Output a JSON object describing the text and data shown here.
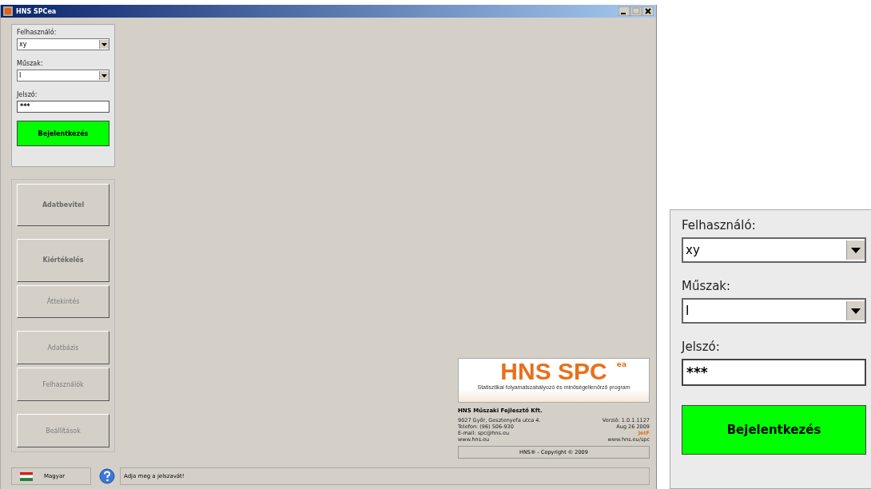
{
  "window": {
    "title": "HNS SPCea"
  },
  "login": {
    "user_label": "Felhasználó:",
    "user_value": "xy",
    "shift_label": "Műszak:",
    "shift_value": "I",
    "password_label": "Jelszó:",
    "password_value": "***",
    "login_button": "Bejelentkezés"
  },
  "nav_buttons": [
    {
      "label": "Adatbevitel",
      "disabled": false,
      "gap_before": false
    },
    {
      "label": "Kiértékelés",
      "disabled": false,
      "gap_before": true
    },
    {
      "label": "Áttekintés",
      "disabled": true,
      "gap_before": false
    },
    {
      "label": "Adatbázis",
      "disabled": true,
      "gap_before": true
    },
    {
      "label": "Felhasználók",
      "disabled": true,
      "gap_before": false
    },
    {
      "label": "Beállítások",
      "disabled": true,
      "gap_before": true
    }
  ],
  "about": {
    "logo_text": "HNS SPC",
    "logo_sup": "ea",
    "logo_subtitle": "Statisztikai folyamatszabályozó és minőségellenőrző program",
    "company": "HNS Műszaki Fejlesztő Kft.",
    "left_lines": [
      "9027 Győr, Gesztenyefa utca 4.",
      "Telefon: (96) 506-930",
      "E-mail: spc@hns.eu",
      "www.hns.eu"
    ],
    "right_lines": [
      "Verzió: 1.0.1.1127",
      "Aug 26 2009",
      "JetF",
      "www.hns.eu/spc"
    ],
    "copyright": "HNS® - Copyright © 2009"
  },
  "status_bar": {
    "language": "Magyar",
    "message": "Adja meg a jelszavát!"
  },
  "zoom_inset": {
    "user_label": "Felhasználó:",
    "user_value": "xy",
    "shift_label": "Műszak:",
    "shift_value": "I",
    "password_label": "Jelszó:",
    "password_value": "***",
    "login_button": "Bejelentkezés"
  }
}
